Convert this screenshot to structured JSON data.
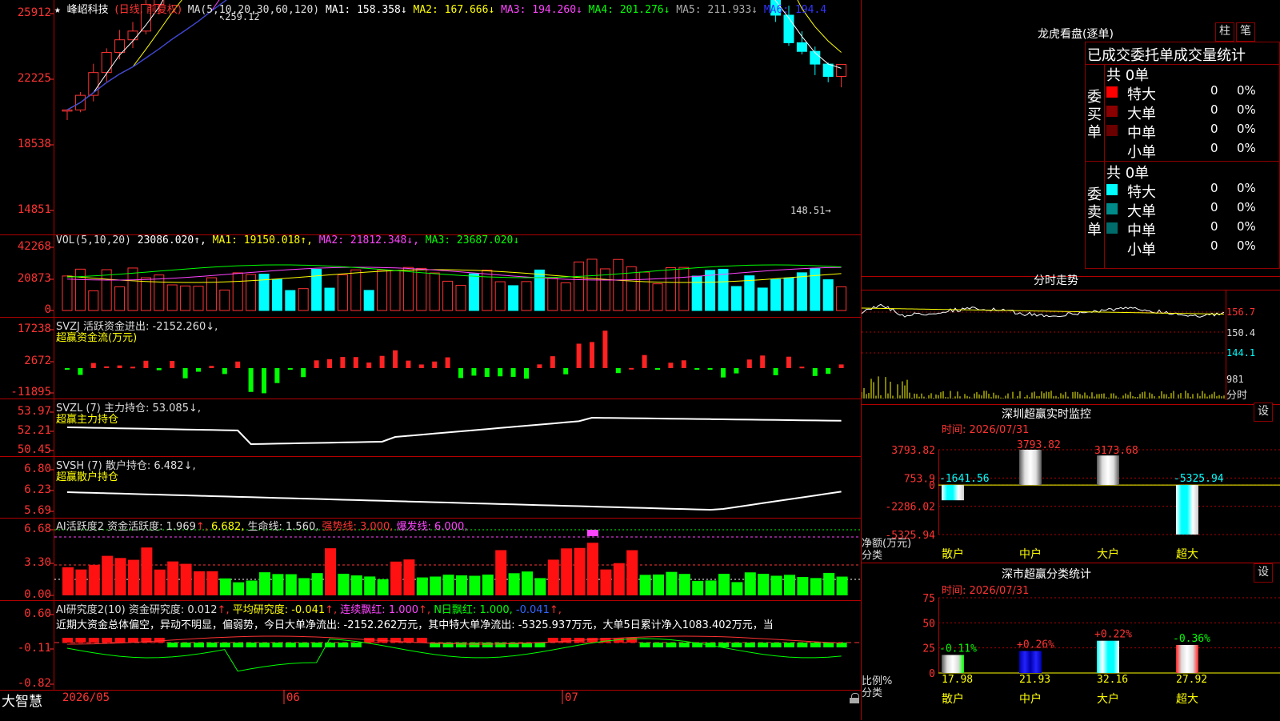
{
  "stock": {
    "star": "★",
    "name": "峰岹科技",
    "period": "(日线, 前复权)",
    "ma_label": "MA(5,10,20,30,60,120)"
  },
  "main_chart": {
    "high_marker": "259.12",
    "low_marker": "148.51",
    "y_ticks": [
      "25912",
      "22225",
      "18538",
      "14851"
    ],
    "ma": [
      {
        "label": "MA1: 158.358↓",
        "color": "#ffffff"
      },
      {
        "label": "MA2: 167.666↓",
        "color": "#ffff00"
      },
      {
        "label": "MA3: 194.260↓",
        "color": "#ff44ff"
      },
      {
        "label": "MA4: 201.276↓",
        "color": "#00ff00"
      },
      {
        "label": "MA5: 211.933↓",
        "color": "#aaaaaa"
      },
      {
        "label": "MA6: 194.4",
        "color": "#3333ff"
      }
    ]
  },
  "vol_chart": {
    "title": "VOL(5,10,20)",
    "value": "23086.020↑,",
    "ma": [
      {
        "label": "MA1: 19150.018↑,",
        "color": "#ffff00"
      },
      {
        "label": "MA2: 21812.348↓,",
        "color": "#ff44ff"
      },
      {
        "label": "MA3: 23687.020↓",
        "color": "#00ff00"
      }
    ],
    "y_ticks": [
      "42268",
      "20873",
      "0"
    ]
  },
  "svzj": {
    "title": "SVZJ  活跃资金进出: -2152.260↓,",
    "subtitle": "超赢资金流(万元)",
    "y_ticks": [
      "17238",
      "2672",
      "-11895"
    ]
  },
  "svzl": {
    "title": "SVZL (7) 主力持仓: 53.085↓,",
    "subtitle": "超赢主力持仓",
    "y_ticks": [
      "53.97",
      "52.21",
      "50.45"
    ]
  },
  "svsh": {
    "title": "SVSH (7) 散户持仓: 6.482↓,",
    "subtitle": "超赢散户持仓",
    "y_ticks": [
      "6.80",
      "6.23",
      "5.69"
    ]
  },
  "ai_active": {
    "parts": [
      {
        "text": "AI活跃度2 资金活跃度: 1.969",
        "color": "#dddddd"
      },
      {
        "text": "↑,",
        "color": "#ff3333"
      },
      {
        "text": " 6.682,",
        "color": "#ffff00"
      },
      {
        "text": " 生命线: 1.560,",
        "color": "#dddddd"
      },
      {
        "text": " 强势线: 3.000,",
        "color": "#ff3333"
      },
      {
        "text": " 爆发线: 6.000,",
        "color": "#ff44ff"
      }
    ],
    "y_ticks": [
      "6.68",
      "3.30",
      "0.00"
    ]
  },
  "ai_research": {
    "parts": [
      {
        "text": "AI研究度2(10) 资金研究度: 0.012",
        "color": "#dddddd"
      },
      {
        "text": "↑,",
        "color": "#ff3333"
      },
      {
        "text": " 平均研究度: -0.041",
        "color": "#ffff00"
      },
      {
        "text": "↑,",
        "color": "#ff3333"
      },
      {
        "text": " 连续飘红: 1.000",
        "color": "#ff44ff"
      },
      {
        "text": "↑,",
        "color": "#ff3333"
      },
      {
        "text": " N日飘红: 1.000,",
        "color": "#00ff00"
      },
      {
        "text": " -0.041",
        "color": "#3366ff"
      },
      {
        "text": "↑,",
        "color": "#ff3333"
      }
    ],
    "comment": "近期大资金总体偏空，异动不明显，偏弱势，今日大单净流出: -2152.262万元，其中特大单净流出: -5325.937万元，大单5日累计净入1083.402万元，当",
    "y_ticks": [
      "0.60",
      "-0.11",
      "-0.82"
    ]
  },
  "bottom_bar": {
    "brand": "大智慧",
    "dates": [
      "2026/05",
      "06",
      "07"
    ],
    "lock_icon": "lock-icon"
  },
  "right_panel": {
    "top": {
      "title": "龙虎看盘(逐单)",
      "btn_bar": "柱",
      "btn_pen": "笔",
      "header": "已成交委托单成交量统计",
      "buy_label": "委买单",
      "sell_label": "委卖单",
      "buy_total": "共 0单",
      "sell_total": "共 0单",
      "buy_rows": [
        {
          "label": "特大",
          "count": "0",
          "pct": "0%",
          "color": "#ff0000"
        },
        {
          "label": "大单",
          "count": "0",
          "pct": "0%",
          "color": "#8b0000"
        },
        {
          "label": "中单",
          "count": "0",
          "pct": "0%",
          "color": "#6b0000"
        },
        {
          "label": "小单",
          "count": "0",
          "pct": "0%",
          "color": ""
        }
      ],
      "sell_rows": [
        {
          "label": "特大",
          "count": "0",
          "pct": "0%",
          "color": "#00ffff"
        },
        {
          "label": "大单",
          "count": "0",
          "pct": "0%",
          "color": "#008b8b"
        },
        {
          "label": "中单",
          "count": "0",
          "pct": "0%",
          "color": "#006b6b"
        },
        {
          "label": "小单",
          "count": "0",
          "pct": "0%",
          "color": ""
        }
      ]
    },
    "intraday": {
      "title": "分时走势",
      "y_ticks": [
        "156.7",
        "150.4",
        "144.1",
        "981"
      ],
      "unit": "分时"
    },
    "monitor": {
      "title": "深圳超赢实时监控",
      "btn": "设",
      "time": "时间: 2026/07/31",
      "y_ticks": [
        "3793.82",
        "753.9",
        "0",
        "-2286.02",
        "-5325.94"
      ],
      "ylabel": "净额(万元)",
      "xlabel": "分类",
      "categories": [
        "散户",
        "中户",
        "大户",
        "超大"
      ],
      "values": [
        -1641.56,
        3793.82,
        3173.68,
        -5325.94
      ],
      "value_labels": [
        "-1641.56",
        "3793.82",
        "3173.68",
        "-5325.94"
      ]
    },
    "classify": {
      "title": "深市超赢分类统计",
      "btn": "设",
      "time": "时间: 2026/07/31",
      "y_ticks": [
        "75",
        "50",
        "25",
        "0"
      ],
      "ylabel": "比例%",
      "xlabel": "分类",
      "categories": [
        "散户",
        "中户",
        "大户",
        "超大"
      ],
      "values": [
        17.98,
        21.93,
        32.16,
        27.92
      ],
      "value_labels": [
        "17.98",
        "21.93",
        "32.16",
        "27.92"
      ],
      "changes": [
        "-0.11%",
        "+0.26%",
        "+0.22%",
        "-0.36%"
      ],
      "change_colors": [
        "#00ff00",
        "#ff3333",
        "#ff3333",
        "#00ff00"
      ]
    }
  },
  "chart_data": [
    {
      "type": "bar",
      "title": "深圳超赢实时监控",
      "ylabel": "净额(万元)",
      "xlabel": "分类",
      "categories": [
        "散户",
        "中户",
        "大户",
        "超大"
      ],
      "values": [
        -1641.56,
        3793.82,
        3173.68,
        -5325.94
      ],
      "ylim": [
        -5325.94,
        3793.82
      ]
    },
    {
      "type": "bar",
      "title": "深市超赢分类统计",
      "ylabel": "比例%",
      "xlabel": "分类",
      "categories": [
        "散户",
        "中户",
        "大户",
        "超大"
      ],
      "values": [
        17.98,
        21.93,
        32.16,
        27.92
      ],
      "ylim": [
        0,
        75
      ]
    }
  ]
}
